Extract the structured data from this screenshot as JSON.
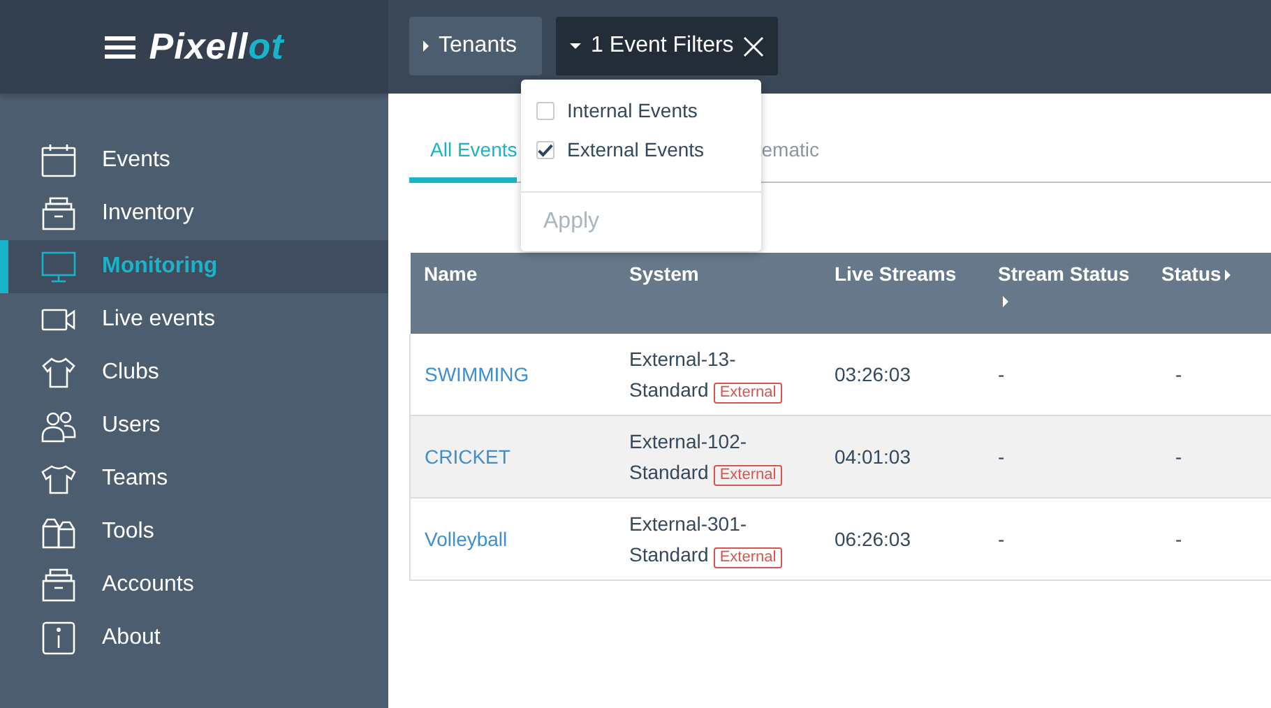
{
  "logo": [
    {
      "text": "Pixell",
      "accent": false
    },
    {
      "text": "ot",
      "accent": true
    }
  ],
  "toolbar": {
    "tenants": "Tenants",
    "filters": "1 Event Filters",
    "filters_open": true
  },
  "filter_menu": {
    "options": [
      {
        "label": "Internal Events",
        "checked": false
      },
      {
        "label": "External Events",
        "checked": true
      }
    ],
    "apply": {
      "label": "Apply",
      "disabled": true
    }
  },
  "sidebar": {
    "items": [
      {
        "label": "Events",
        "selected": false
      },
      {
        "label": "Inventory",
        "selected": false
      },
      {
        "label": "Monitoring",
        "selected": true
      },
      {
        "label": "Live events",
        "selected": false
      },
      {
        "label": "Clubs",
        "selected": false
      },
      {
        "label": "Users",
        "selected": false
      },
      {
        "label": "Teams",
        "selected": false
      },
      {
        "label": "Tools",
        "selected": false
      },
      {
        "label": "Accounts",
        "selected": false
      },
      {
        "label": "About",
        "selected": false
      }
    ]
  },
  "tabs": [
    {
      "label": "All Events",
      "selected": true
    },
    {
      "label": "ematic",
      "selected": false
    }
  ],
  "table": {
    "columns": [
      {
        "label": "Name",
        "arrow": false
      },
      {
        "label": "System",
        "arrow": false
      },
      {
        "label": "Live Streams",
        "arrow": false
      },
      {
        "label": "Stream Status",
        "arrow": true
      },
      {
        "label": "Status",
        "arrow": true
      }
    ],
    "rows": [
      {
        "name": "SWIMMING",
        "system_lines": [
          "External-13-",
          "Standard"
        ],
        "tag": "External",
        "live": "03:26:03",
        "stream_status": "-",
        "status": "-"
      },
      {
        "name": "CRICKET",
        "system_lines": [
          "External-102-",
          "Standard"
        ],
        "tag": "External",
        "live": "04:01:03",
        "stream_status": "-",
        "status": "-"
      },
      {
        "name": "Volleyball",
        "system_lines": [
          "External-301-",
          "Standard"
        ],
        "tag": "External",
        "live": "06:26:03",
        "stream_status": "-",
        "status": "-"
      }
    ]
  }
}
